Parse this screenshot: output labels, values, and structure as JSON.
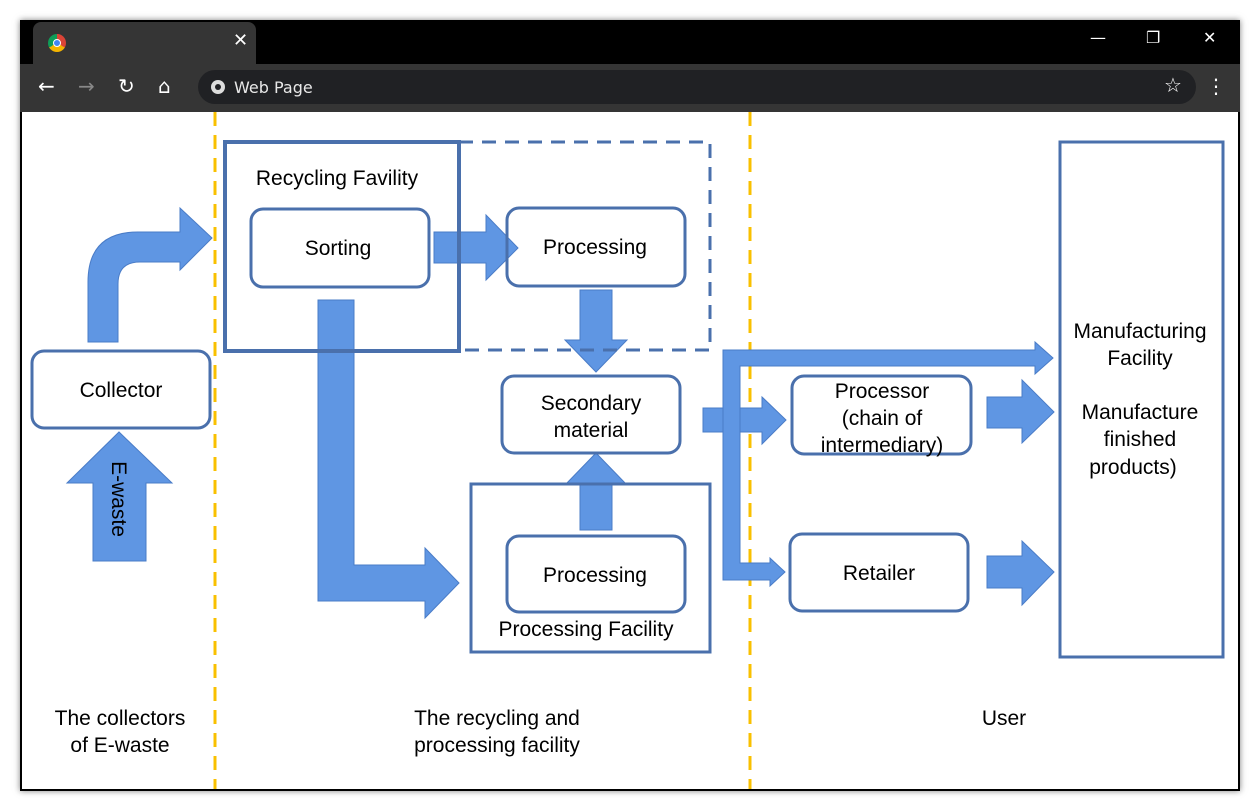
{
  "browser": {
    "tab_title": "",
    "address": "Web Page",
    "close_label": "✕",
    "back": "←",
    "forward": "→",
    "reload": "↻",
    "home": "⌂",
    "star": "☆",
    "menu": "⋮",
    "minimize": "—",
    "maximize": "❐",
    "close_window": "✕"
  },
  "colors": {
    "arrow": "#5f96e3",
    "box_border": "#4a70ac",
    "divider": "#f9c000"
  },
  "diagram": {
    "recycling_facility": "Recycling Favility",
    "sorting": "Sorting",
    "processing_top": "Processing",
    "secondary_material": [
      "Secondary",
      "material"
    ],
    "processing_bottom": "Processing",
    "processing_facility": "Processing Facility",
    "collector": "Collector",
    "ewaste": "E-waste",
    "processor": [
      "Processor",
      "(chain  of",
      "intermediary)"
    ],
    "retailer": "Retailer",
    "manufacturing": [
      "Manufacturing",
      "Facility",
      "",
      "Manufacture",
      "finished",
      "products)"
    ],
    "columns": [
      [
        "The collectors",
        "of E-waste"
      ],
      [
        "The recycling and",
        "processing facility"
      ],
      [
        "User"
      ]
    ]
  }
}
